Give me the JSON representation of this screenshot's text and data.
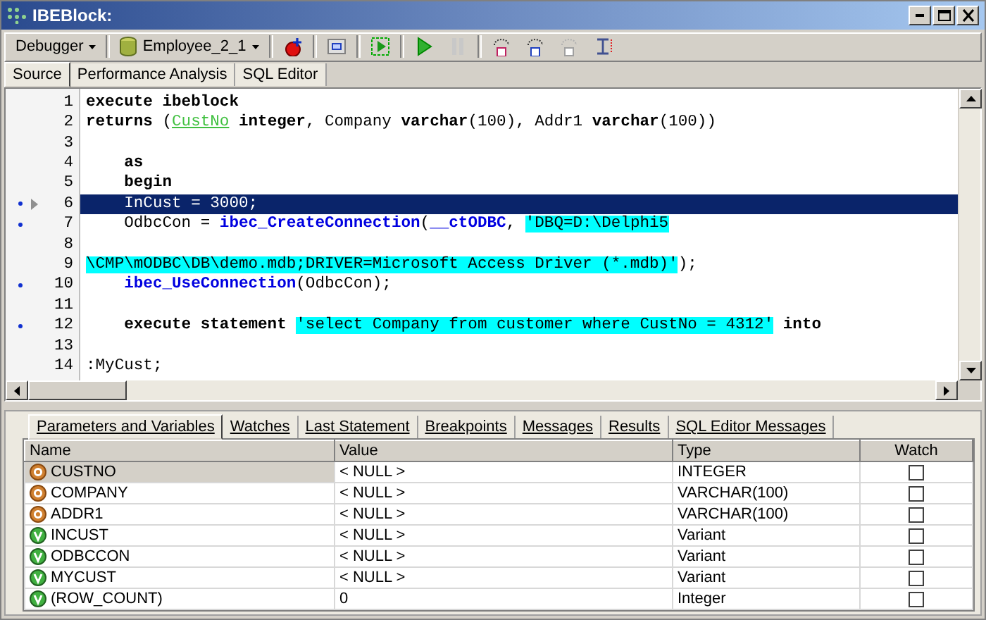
{
  "window": {
    "title": "IBEBlock:"
  },
  "toolbar": {
    "debugger_menu": "Debugger",
    "database_menu": "Employee_2_1"
  },
  "view_tabs": [
    {
      "label": "Source",
      "selected": true
    },
    {
      "label": "Performance Analysis",
      "selected": false
    },
    {
      "label": "SQL Editor",
      "selected": false
    }
  ],
  "editor": {
    "lines": [
      {
        "number": "1",
        "breakpoint": false,
        "current": false,
        "segments": [
          {
            "kind": "kw",
            "text": "execute ibeblock"
          }
        ]
      },
      {
        "number": "2",
        "breakpoint": false,
        "current": false,
        "segments": [
          {
            "kind": "kw",
            "text": "returns "
          },
          {
            "kind": "plain",
            "text": "("
          },
          {
            "kind": "param",
            "text": "CustNo"
          },
          {
            "kind": "kw",
            "text": " integer"
          },
          {
            "kind": "plain",
            "text": ", Company "
          },
          {
            "kind": "kw",
            "text": "varchar"
          },
          {
            "kind": "plain",
            "text": "(100), Addr1 "
          },
          {
            "kind": "kw",
            "text": "varchar"
          },
          {
            "kind": "plain",
            "text": "(100))"
          }
        ]
      },
      {
        "number": "3",
        "breakpoint": false,
        "current": false
      },
      {
        "number": "4",
        "breakpoint": false,
        "current": false,
        "segments": [
          {
            "kind": "kw",
            "text": "    as"
          }
        ]
      },
      {
        "number": "5",
        "breakpoint": false,
        "current": false,
        "segments": [
          {
            "kind": "kw",
            "text": "    begin"
          }
        ]
      },
      {
        "number": "6",
        "breakpoint": true,
        "current": true,
        "segments": [
          {
            "kind": "plain",
            "text": "    InCust = 3000;"
          }
        ]
      },
      {
        "number": "7",
        "breakpoint": true,
        "current": false,
        "segments": [
          {
            "kind": "plain",
            "text": "    OdbcCon = "
          },
          {
            "kind": "fn",
            "text": "ibec_CreateConnection"
          },
          {
            "kind": "plain",
            "text": "("
          },
          {
            "kind": "fn",
            "text": "__ctODBC"
          },
          {
            "kind": "plain",
            "text": ", "
          },
          {
            "kind": "str",
            "text": "'DBQ=D:\\Delphi5"
          }
        ]
      },
      {
        "number": "8",
        "breakpoint": false,
        "current": false
      },
      {
        "number": "9",
        "breakpoint": false,
        "current": false,
        "segments": [
          {
            "kind": "str",
            "text": "\\CMP\\mODBC\\DB\\demo.mdb;DRIVER=Microsoft Access Driver (*.mdb)'"
          },
          {
            "kind": "plain",
            "text": ");"
          }
        ]
      },
      {
        "number": "10",
        "breakpoint": true,
        "current": false,
        "segments": [
          {
            "kind": "fn",
            "text": "    ibec_UseConnection"
          },
          {
            "kind": "plain",
            "text": "(OdbcCon);"
          }
        ]
      },
      {
        "number": "11",
        "breakpoint": false,
        "current": false
      },
      {
        "number": "12",
        "breakpoint": true,
        "current": false,
        "segments": [
          {
            "kind": "kw",
            "text": "    execute statement "
          },
          {
            "kind": "str",
            "text": "'select Company from customer where CustNo = 4312'"
          },
          {
            "kind": "kw",
            "text": " into"
          }
        ]
      },
      {
        "number": "13",
        "breakpoint": false,
        "current": false
      },
      {
        "number": "14",
        "breakpoint": false,
        "current": false,
        "segments": [
          {
            "kind": "plain",
            "text": ":MyCust;"
          }
        ]
      }
    ]
  },
  "debug_tabs": [
    {
      "label": "Parameters and Variables",
      "selected": true
    },
    {
      "label": "Watches",
      "selected": false
    },
    {
      "label": "Last Statement",
      "selected": false
    },
    {
      "label": "Breakpoints",
      "selected": false
    },
    {
      "label": "Messages",
      "selected": false
    },
    {
      "label": "Results",
      "selected": false
    },
    {
      "label": "SQL Editor Messages",
      "selected": false
    }
  ],
  "table": {
    "columns": [
      "Name",
      "Value",
      "Type",
      "Watch"
    ],
    "rows": [
      {
        "kind": "output",
        "name": "CUSTNO",
        "value": "< NULL >",
        "type": "INTEGER",
        "watch": false,
        "selected": true
      },
      {
        "kind": "output",
        "name": "COMPANY",
        "value": "< NULL >",
        "type": "VARCHAR(100)",
        "watch": false,
        "selected": false
      },
      {
        "kind": "output",
        "name": "ADDR1",
        "value": "< NULL >",
        "type": "VARCHAR(100)",
        "watch": false,
        "selected": false
      },
      {
        "kind": "variable",
        "name": "INCUST",
        "value": "< NULL >",
        "type": "Variant",
        "watch": false,
        "selected": false
      },
      {
        "kind": "variable",
        "name": "ODBCCON",
        "value": "< NULL >",
        "type": "Variant",
        "watch": false,
        "selected": false
      },
      {
        "kind": "variable",
        "name": "MYCUST",
        "value": "< NULL >",
        "type": "Variant",
        "watch": false,
        "selected": false
      },
      {
        "kind": "variable",
        "name": "(ROW_COUNT)",
        "value": "0",
        "type": "Integer",
        "watch": false,
        "selected": false
      }
    ]
  }
}
